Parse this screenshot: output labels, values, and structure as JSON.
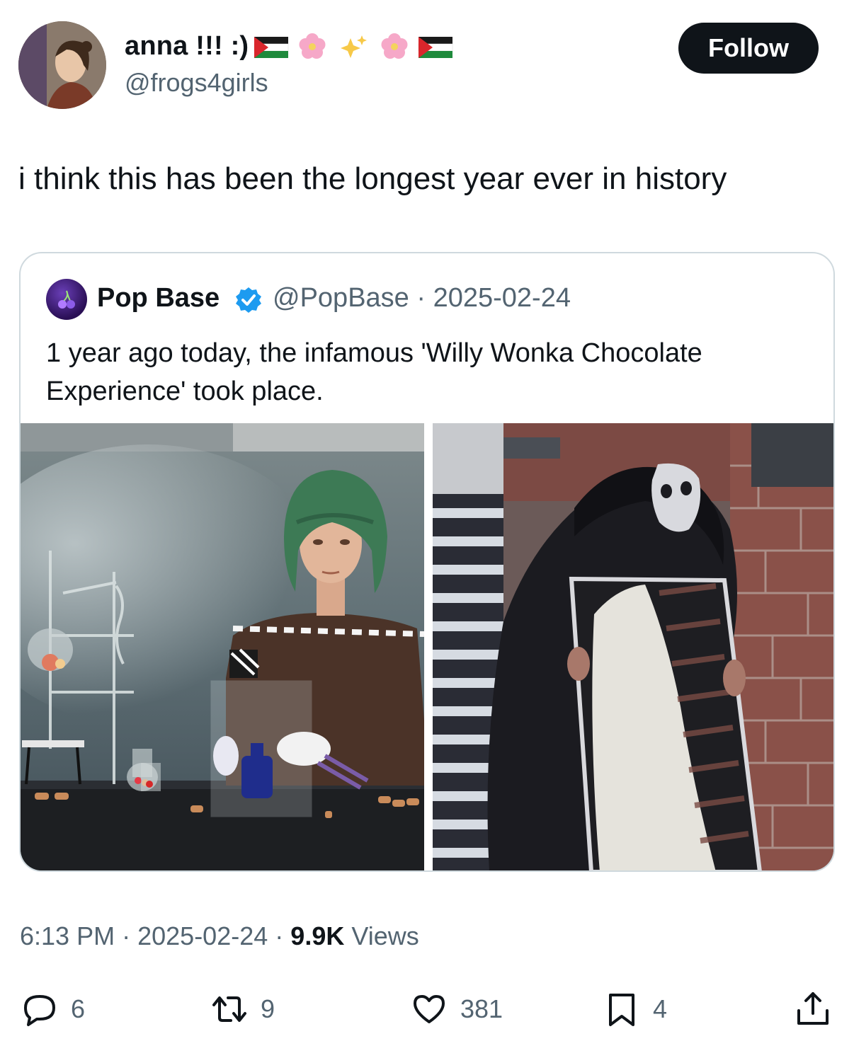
{
  "author": {
    "display_name": "anna !!! :)",
    "handle": "@frogs4girls",
    "follow_label": "Follow",
    "name_emojis": [
      "palestine-flag",
      "cherry-blossom",
      "sparkles",
      "cherry-blossom",
      "palestine-flag"
    ]
  },
  "tweet": {
    "text": "i think this has been the longest year ever in history",
    "time": "6:13 PM",
    "date": "2025-02-24",
    "views_count": "9.9K",
    "views_label": "Views",
    "separator": "·"
  },
  "quote": {
    "name": "Pop Base",
    "handle": "@PopBase",
    "separator": "·",
    "date": "2025-02-24",
    "text": "1 year ago today, the infamous 'Willy Wonka Chocolate Experience' took place.",
    "media": [
      "oompa-loompa-photo",
      "dark-figure-mirror-photo"
    ]
  },
  "actions": {
    "replies": "6",
    "reposts": "9",
    "likes": "381",
    "bookmarks": "4"
  },
  "colors": {
    "text": "#0f1419",
    "secondary": "#536471",
    "border": "#cfd9de",
    "verified": "#1d9bf0",
    "follow_bg": "#0f1419"
  }
}
